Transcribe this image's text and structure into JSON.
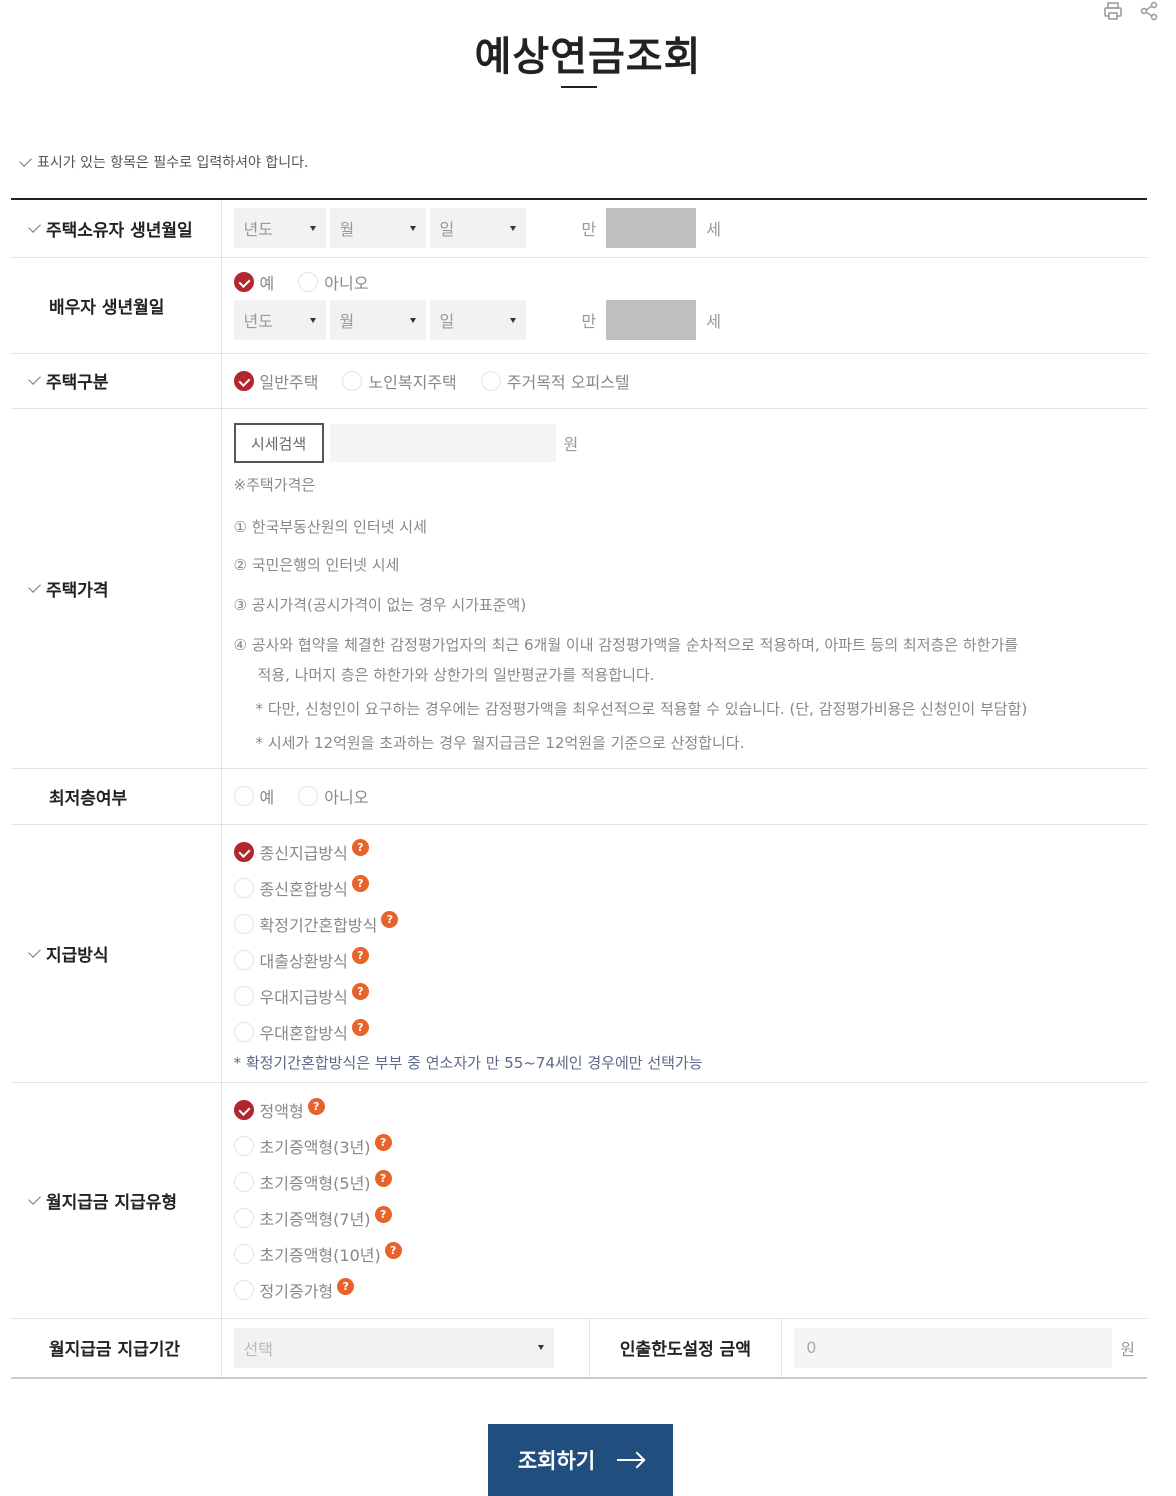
{
  "page": {
    "title": "예상연금조회",
    "notice": "표시가 있는 항목은 필수로 입력하셔야 합니다."
  },
  "icons": {
    "print": "print-icon",
    "share": "share-icon",
    "help": "help-bubble-icon"
  },
  "colors": {
    "accent_red": "#b3262e",
    "help_orange": "#e8622b",
    "submit_blue": "#1f4e7f"
  },
  "owner_birth": {
    "label": "주택소유자 생년월일",
    "year": "년도",
    "month": "월",
    "day": "일",
    "age_prefix": "만",
    "age_suffix": "세"
  },
  "spouse_birth": {
    "label": "배우자 생년월일",
    "yes": "예",
    "no": "아니오",
    "year": "년도",
    "month": "월",
    "day": "일",
    "age_prefix": "만",
    "age_suffix": "세"
  },
  "house_type": {
    "label": "주택구분",
    "options": [
      "일반주택",
      "노인복지주택",
      "주거목적 오피스텔"
    ]
  },
  "house_price": {
    "label": "주택가격",
    "search_button": "시세검색",
    "unit": "원",
    "note_title": "※주택가격은",
    "items": [
      "① 한국부동산원의 인터넷 시세",
      "② 국민은행의 인터넷 시세",
      "③ 공시가격(공시가격이 없는 경우 시가표준액)",
      "④ 공사와 협약을 체결한 감정평가업자의 최근 6개월 이내 감정평가액을 순차적으로 적용하며, 아파트 등의 최저층은 하한가를",
      "적용, 나머지 층은 하한가와 상한가의 일반평균가를 적용합니다."
    ],
    "notes": [
      "* 다만, 신청인이 요구하는 경우에는 감정평가액을 최우선적으로 적용할 수 있습니다. (단, 감정평가비용은 신청인이 부담함)",
      "* 시세가 12억원을 초과하는 경우 월지급금은 12억원을 기준으로 산정합니다."
    ]
  },
  "lowest_floor": {
    "label": "최저층여부",
    "yes": "예",
    "no": "아니오"
  },
  "payment_method": {
    "label": "지급방식",
    "options": [
      "종신지급방식",
      "종신혼합방식",
      "확정기간혼합방식",
      "대출상환방식",
      "우대지급방식",
      "우대혼합방식"
    ],
    "footnote": "* 확정기간혼합방식은 부부 중 연소자가 만 55~74세인 경우에만 선택가능"
  },
  "monthly_type": {
    "label": "월지급금 지급유형",
    "options": [
      "정액형",
      "초기증액형(3년)",
      "초기증액형(5년)",
      "초기증액형(7년)",
      "초기증액형(10년)",
      "정기증가형"
    ]
  },
  "period": {
    "label": "월지급금 지급기간",
    "select_placeholder": "선택",
    "limit_label": "인출한도설정 금액",
    "limit_value": "0",
    "unit": "원"
  },
  "submit": {
    "label": "조회하기"
  }
}
